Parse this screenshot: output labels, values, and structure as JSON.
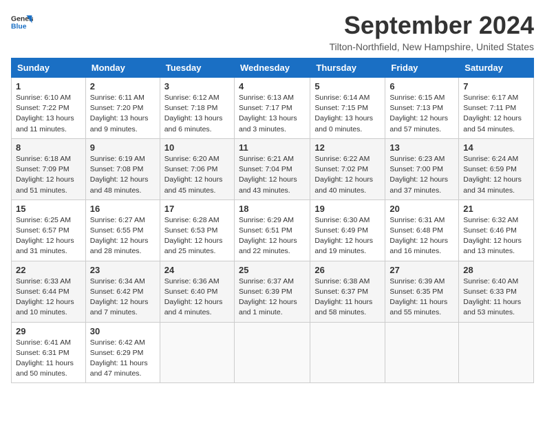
{
  "header": {
    "logo_line1": "General",
    "logo_line2": "Blue",
    "month_title": "September 2024",
    "location": "Tilton-Northfield, New Hampshire, United States"
  },
  "weekdays": [
    "Sunday",
    "Monday",
    "Tuesday",
    "Wednesday",
    "Thursday",
    "Friday",
    "Saturday"
  ],
  "weeks": [
    [
      {
        "day": "1",
        "info": "Sunrise: 6:10 AM\nSunset: 7:22 PM\nDaylight: 13 hours\nand 11 minutes."
      },
      {
        "day": "2",
        "info": "Sunrise: 6:11 AM\nSunset: 7:20 PM\nDaylight: 13 hours\nand 9 minutes."
      },
      {
        "day": "3",
        "info": "Sunrise: 6:12 AM\nSunset: 7:18 PM\nDaylight: 13 hours\nand 6 minutes."
      },
      {
        "day": "4",
        "info": "Sunrise: 6:13 AM\nSunset: 7:17 PM\nDaylight: 13 hours\nand 3 minutes."
      },
      {
        "day": "5",
        "info": "Sunrise: 6:14 AM\nSunset: 7:15 PM\nDaylight: 13 hours\nand 0 minutes."
      },
      {
        "day": "6",
        "info": "Sunrise: 6:15 AM\nSunset: 7:13 PM\nDaylight: 12 hours\nand 57 minutes."
      },
      {
        "day": "7",
        "info": "Sunrise: 6:17 AM\nSunset: 7:11 PM\nDaylight: 12 hours\nand 54 minutes."
      }
    ],
    [
      {
        "day": "8",
        "info": "Sunrise: 6:18 AM\nSunset: 7:09 PM\nDaylight: 12 hours\nand 51 minutes."
      },
      {
        "day": "9",
        "info": "Sunrise: 6:19 AM\nSunset: 7:08 PM\nDaylight: 12 hours\nand 48 minutes."
      },
      {
        "day": "10",
        "info": "Sunrise: 6:20 AM\nSunset: 7:06 PM\nDaylight: 12 hours\nand 45 minutes."
      },
      {
        "day": "11",
        "info": "Sunrise: 6:21 AM\nSunset: 7:04 PM\nDaylight: 12 hours\nand 43 minutes."
      },
      {
        "day": "12",
        "info": "Sunrise: 6:22 AM\nSunset: 7:02 PM\nDaylight: 12 hours\nand 40 minutes."
      },
      {
        "day": "13",
        "info": "Sunrise: 6:23 AM\nSunset: 7:00 PM\nDaylight: 12 hours\nand 37 minutes."
      },
      {
        "day": "14",
        "info": "Sunrise: 6:24 AM\nSunset: 6:59 PM\nDaylight: 12 hours\nand 34 minutes."
      }
    ],
    [
      {
        "day": "15",
        "info": "Sunrise: 6:25 AM\nSunset: 6:57 PM\nDaylight: 12 hours\nand 31 minutes."
      },
      {
        "day": "16",
        "info": "Sunrise: 6:27 AM\nSunset: 6:55 PM\nDaylight: 12 hours\nand 28 minutes."
      },
      {
        "day": "17",
        "info": "Sunrise: 6:28 AM\nSunset: 6:53 PM\nDaylight: 12 hours\nand 25 minutes."
      },
      {
        "day": "18",
        "info": "Sunrise: 6:29 AM\nSunset: 6:51 PM\nDaylight: 12 hours\nand 22 minutes."
      },
      {
        "day": "19",
        "info": "Sunrise: 6:30 AM\nSunset: 6:49 PM\nDaylight: 12 hours\nand 19 minutes."
      },
      {
        "day": "20",
        "info": "Sunrise: 6:31 AM\nSunset: 6:48 PM\nDaylight: 12 hours\nand 16 minutes."
      },
      {
        "day": "21",
        "info": "Sunrise: 6:32 AM\nSunset: 6:46 PM\nDaylight: 12 hours\nand 13 minutes."
      }
    ],
    [
      {
        "day": "22",
        "info": "Sunrise: 6:33 AM\nSunset: 6:44 PM\nDaylight: 12 hours\nand 10 minutes."
      },
      {
        "day": "23",
        "info": "Sunrise: 6:34 AM\nSunset: 6:42 PM\nDaylight: 12 hours\nand 7 minutes."
      },
      {
        "day": "24",
        "info": "Sunrise: 6:36 AM\nSunset: 6:40 PM\nDaylight: 12 hours\nand 4 minutes."
      },
      {
        "day": "25",
        "info": "Sunrise: 6:37 AM\nSunset: 6:39 PM\nDaylight: 12 hours\nand 1 minute."
      },
      {
        "day": "26",
        "info": "Sunrise: 6:38 AM\nSunset: 6:37 PM\nDaylight: 11 hours\nand 58 minutes."
      },
      {
        "day": "27",
        "info": "Sunrise: 6:39 AM\nSunset: 6:35 PM\nDaylight: 11 hours\nand 55 minutes."
      },
      {
        "day": "28",
        "info": "Sunrise: 6:40 AM\nSunset: 6:33 PM\nDaylight: 11 hours\nand 53 minutes."
      }
    ],
    [
      {
        "day": "29",
        "info": "Sunrise: 6:41 AM\nSunset: 6:31 PM\nDaylight: 11 hours\nand 50 minutes."
      },
      {
        "day": "30",
        "info": "Sunrise: 6:42 AM\nSunset: 6:29 PM\nDaylight: 11 hours\nand 47 minutes."
      },
      {
        "day": "",
        "info": ""
      },
      {
        "day": "",
        "info": ""
      },
      {
        "day": "",
        "info": ""
      },
      {
        "day": "",
        "info": ""
      },
      {
        "day": "",
        "info": ""
      }
    ]
  ]
}
